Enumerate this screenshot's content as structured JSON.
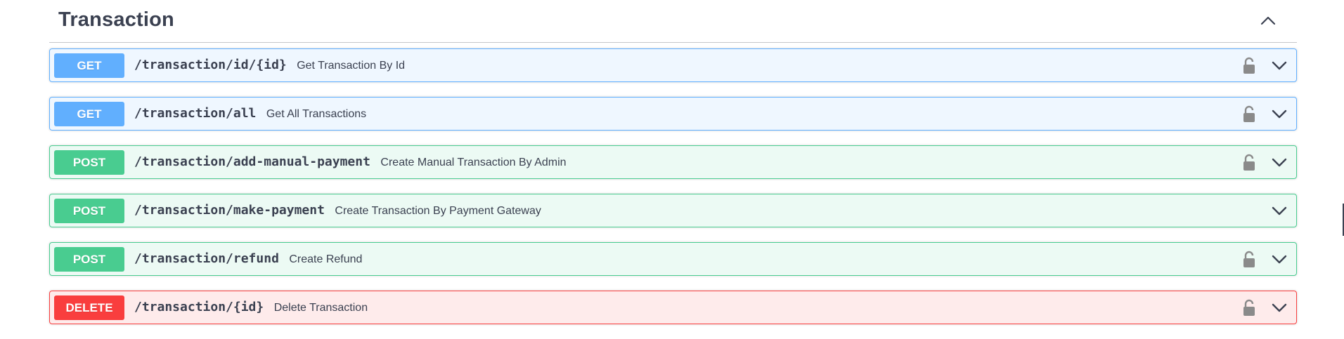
{
  "section": {
    "title": "Transaction",
    "collapse_icon": "chevron-up-icon"
  },
  "operations": [
    {
      "method": "GET",
      "path": "/transaction/id/{id}",
      "summary": "Get Transaction By Id",
      "locked": true
    },
    {
      "method": "GET",
      "path": "/transaction/all",
      "summary": "Get All Transactions",
      "locked": true
    },
    {
      "method": "POST",
      "path": "/transaction/add-manual-payment",
      "summary": "Create Manual Transaction By Admin",
      "locked": true
    },
    {
      "method": "POST",
      "path": "/transaction/make-payment",
      "summary": "Create Transaction By Payment Gateway",
      "locked": false
    },
    {
      "method": "POST",
      "path": "/transaction/refund",
      "summary": "Create Refund",
      "locked": true
    },
    {
      "method": "DELETE",
      "path": "/transaction/{id}",
      "summary": "Delete Transaction",
      "locked": true
    }
  ],
  "colors": {
    "get": "#61affe",
    "post": "#49cc90",
    "delete": "#f93e3e",
    "text": "#3b4151",
    "lock": "#8a8a8a"
  }
}
